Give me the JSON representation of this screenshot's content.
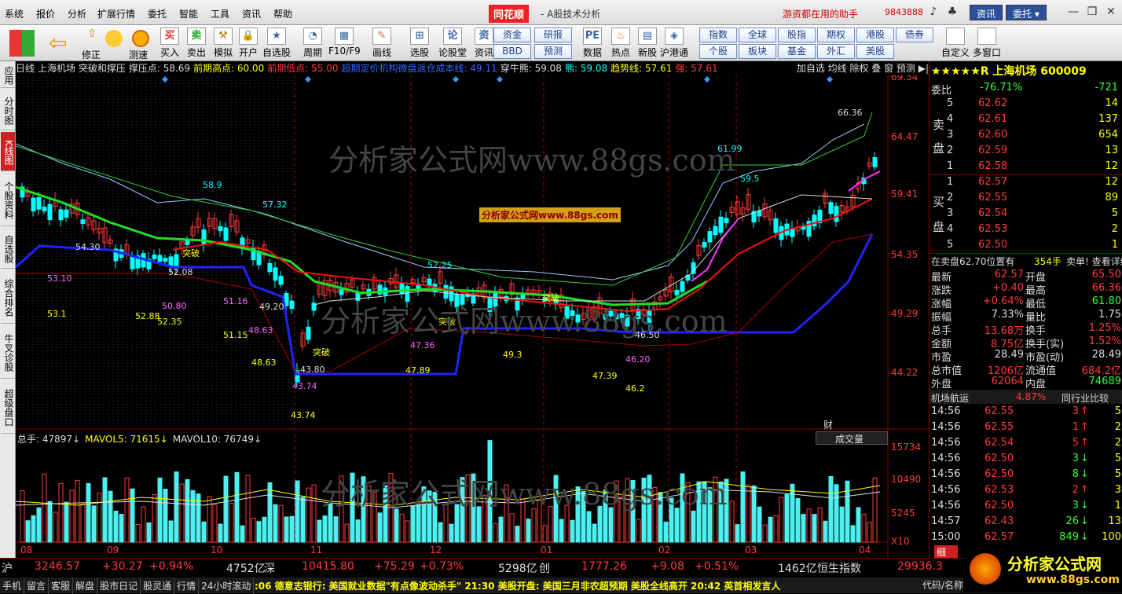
{
  "menu": [
    "系统",
    "报价",
    "分析",
    "扩展行情",
    "委托",
    "智能",
    "工具",
    "资讯",
    "帮助"
  ],
  "logo": "同花顺",
  "app_title": "- A股技术分析",
  "slogan": "游资都在用的助手",
  "phone": "9843888",
  "top_buttons": [
    "资讯",
    "委托 ▾"
  ],
  "win": {
    "min": "—",
    "max": "❐",
    "close": "✕"
  },
  "toolbar": [
    "买入",
    "卖出",
    "模拟",
    "开户",
    "自选股",
    "周期",
    "F10/F9",
    "画线",
    "选股",
    "论股堂",
    "资讯",
    "数据",
    "热点",
    "新股",
    "沪港通",
    "自定义",
    "多窗口"
  ],
  "toolbar_misc": [
    "修正",
    "测速"
  ],
  "quick": [
    "资金",
    "研报",
    "BBD",
    "预测",
    "指数",
    "全球",
    "股指",
    "期权",
    "港股",
    "债券",
    "个股",
    "板块",
    "基金",
    "外汇",
    "美股"
  ],
  "sidetabs": [
    "应用",
    "分时图",
    "K线图",
    "个股资料",
    "自选股",
    "综合排名",
    "牛叉诊股",
    "超级盘口"
  ],
  "chart": {
    "info": [
      {
        "t": "日线",
        "c": "#ddd"
      },
      {
        "t": "上海机场 突破和撑压",
        "c": "#ddd"
      },
      {
        "t": "撑压点: 58.69",
        "c": "#ddd"
      },
      {
        "t": "前期高点: 60.00",
        "c": "#ff0"
      },
      {
        "t": "前期低点: 55.00",
        "c": "#ff3a3a"
      },
      {
        "t": "超期定价机构微盘返仓成本线: 49.11",
        "c": "#36f"
      },
      {
        "t": "穿牛熊: 59.08",
        "c": "#ddd"
      },
      {
        "t": "熊: 59.08",
        "c": "#0ff"
      },
      {
        "t": "趋势线: 57.61",
        "c": "#ff0"
      },
      {
        "t": "强: 57.61",
        "c": "#ff3a3a"
      }
    ],
    "buttons": "加自选 均线 除权 叠 窗 预测 ▶|",
    "y_labels": [
      "69.54",
      "64.47",
      "59.41",
      "54.35",
      "49.29",
      "44.22"
    ],
    "vol_y": [
      "15734",
      "10490",
      "5245",
      "X10"
    ],
    "months": [
      "08",
      "09",
      "10",
      "11",
      "12",
      "01",
      "02",
      "03",
      "04"
    ],
    "vol_info": [
      {
        "t": "总手: 47897↓",
        "c": "#ddd"
      },
      {
        "t": "MAVOL5: 71615↓",
        "c": "#ff0"
      },
      {
        "t": "MAVOL10: 76749↓",
        "c": "#ddd"
      }
    ],
    "vol_select": "成交量",
    "watermark": "分析家公式网www.88gs.com",
    "banner": "分析家公式网www.88gs.com",
    "fin": "财",
    "labels": [
      {
        "t": "53.10",
        "c": "#f6f"
      },
      {
        "t": "53.1",
        "c": "#ff0"
      },
      {
        "t": "54.30",
        "c": "#ddd"
      },
      {
        "t": "52.88",
        "c": "#ff0"
      },
      {
        "t": "50.80",
        "c": "#f6f"
      },
      {
        "t": "52.35",
        "c": "#ff0"
      },
      {
        "t": "52.08",
        "c": "#ddd"
      },
      {
        "t": "58.9",
        "c": "#0ff"
      },
      {
        "t": "57.32",
        "c": "#0ff"
      },
      {
        "t": "51.16",
        "c": "#f6f"
      },
      {
        "t": "51.15",
        "c": "#ff0"
      },
      {
        "t": "48.63",
        "c": "#f6f"
      },
      {
        "t": "48.63",
        "c": "#ff0"
      },
      {
        "t": "43.80",
        "c": "#ddd"
      },
      {
        "t": "43.74",
        "c": "#f6f"
      },
      {
        "t": "43.74",
        "c": "#ff0"
      },
      {
        "t": "49.20",
        "c": "#ddd"
      },
      {
        "t": "47.36",
        "c": "#f6f"
      },
      {
        "t": "47.89",
        "c": "#ff0"
      },
      {
        "t": "49.3",
        "c": "#ff0"
      },
      {
        "t": "52.25",
        "c": "#0ff"
      },
      {
        "t": "47.39",
        "c": "#ff0"
      },
      {
        "t": "46.20",
        "c": "#f6f"
      },
      {
        "t": "46.2",
        "c": "#ff0"
      },
      {
        "t": "46.50",
        "c": "#ddd"
      },
      {
        "t": "61.99",
        "c": "#0ff"
      },
      {
        "t": "59.5",
        "c": "#0ff"
      },
      {
        "t": "66.36",
        "c": "#ddd"
      },
      {
        "t": "突破",
        "c": "#ff0"
      },
      {
        "t": "突破",
        "c": "#ff0"
      },
      {
        "t": "突破",
        "c": "#ff0"
      },
      {
        "t": "突破",
        "c": "#ff0"
      }
    ]
  },
  "colors": {
    "bg": "#000000",
    "up": "#ff3a3a",
    "down": "#00ffff",
    "ma": "#ffff00",
    "frame": "#800000"
  },
  "rp": {
    "title": "★★★★★R 上海机场 600009",
    "weibi": {
      "l": "委比",
      "v": "-76.71%",
      "n": "-721"
    },
    "asks": [
      [
        "5",
        "62.62",
        "14"
      ],
      [
        "4",
        "62.61",
        "137"
      ],
      [
        "3",
        "62.60",
        "654"
      ],
      [
        "2",
        "62.59",
        "13"
      ],
      [
        "1",
        "62.58",
        "12"
      ]
    ],
    "bids": [
      [
        "1",
        "62.57",
        "12"
      ],
      [
        "2",
        "62.55",
        "89"
      ],
      [
        "3",
        "62.54",
        "5"
      ],
      [
        "4",
        "62.53",
        "2"
      ],
      [
        "5",
        "62.50",
        "1"
      ]
    ],
    "mai": "卖",
    "pan": "盘",
    "buy": "买",
    "pan2": "盘",
    "status": {
      "a": "在卖盘62.70位置有",
      "b": "354手",
      "c": "卖单! 查看详细"
    },
    "stats": [
      [
        "最新",
        "62.57",
        "开盘",
        "65.50"
      ],
      [
        "涨跌",
        "+0.40",
        "最高",
        "66.36"
      ],
      [
        "涨幅",
        "+0.64%",
        "最低",
        "61.80"
      ],
      [
        "振幅",
        "7.33%",
        "量比",
        "1.75"
      ],
      [
        "总手",
        "13.68万",
        "换手",
        "1.25%"
      ],
      [
        "金额",
        "8.75亿",
        "换手(实)",
        "1.52%"
      ],
      [
        "市盈",
        "28.49",
        "市盈(动)",
        "28.49"
      ],
      [
        "总市值",
        "1206亿",
        "流通值",
        "684.2亿"
      ],
      [
        "外盘",
        "62064",
        "内盘",
        "74689"
      ]
    ],
    "industry": {
      "name": "机场航运",
      "pct": "4.87%",
      "cmp": "同行业比较"
    },
    "ticks": [
      [
        "14:56",
        "62.55",
        "3",
        "↑",
        "5"
      ],
      [
        "14:56",
        "62.55",
        "1",
        "↑",
        "2"
      ],
      [
        "14:56",
        "62.54",
        "5",
        "↑",
        "2"
      ],
      [
        "14:56",
        "62.50",
        "3",
        "↓",
        "5"
      ],
      [
        "14:56",
        "62.50",
        "8",
        "↓",
        "5"
      ],
      [
        "14:56",
        "62.53",
        "2",
        "↑",
        "3"
      ],
      [
        "14:56",
        "62.50",
        "3",
        "↓",
        "1"
      ],
      [
        "14:57",
        "62.43",
        "26",
        "↓",
        "13"
      ],
      [
        "15:00",
        "62.57",
        "849",
        "↓",
        "100"
      ]
    ],
    "tick_tab": "细"
  },
  "index": {
    "sh": {
      "n": "沪",
      "v": "3246.57",
      "c": "+30.27",
      "p": "+0.94%",
      "a": "4752亿"
    },
    "sz": {
      "n": "深",
      "v": "10415.80",
      "c": "+75.29",
      "p": "+0.73%",
      "a": "5298亿"
    },
    "cy": {
      "n": "创",
      "v": "1777.26",
      "c": "+9.08",
      "p": "+0.51%",
      "a": "1462亿"
    },
    "hs": {
      "n": "恒生指数",
      "v": "29936.3"
    }
  },
  "bnav": [
    "手机",
    "留言",
    "客服",
    "解盘",
    "股市日记",
    "股灵通",
    "行情",
    "24小时滚动"
  ],
  "ticker": ":06 德意志银行: 美国就业数据\"有点像波动杀手\"        21:30 美股开盘: 美国三月非农超预期 美股全线高开        20:42 英首相发言人",
  "bnav_right": "代码/名称",
  "brand": {
    "t": "分析家公式网",
    "u": "www.88gs.com"
  }
}
